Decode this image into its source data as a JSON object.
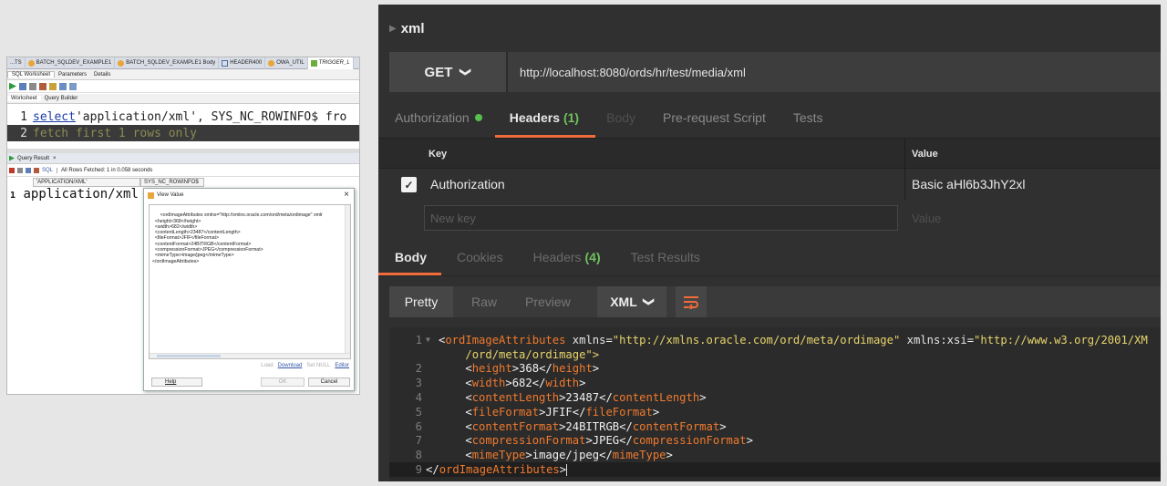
{
  "sqldev": {
    "doc_tabs": [
      {
        "label": "...TS",
        "icon": "none"
      },
      {
        "label": "BATCH_SQLDEV_EXAMPLE1",
        "icon": "orange-db-icon"
      },
      {
        "label": "BATCH_SQLDEV_EXAMPLE1 Body",
        "icon": "orange-db-icon"
      },
      {
        "label": "HEADER400",
        "icon": "table-icon"
      },
      {
        "label": "OWA_UTIL",
        "icon": "orange-db-icon"
      },
      {
        "label": "TRIGGER_L",
        "icon": "trigger-icon"
      }
    ],
    "sub_tabs": [
      "SQL Worksheet",
      "Parameters",
      "Details"
    ],
    "worksheet_tabs": [
      "Worksheet",
      "Query Builder"
    ],
    "code": [
      {
        "num": "1",
        "kw": "select",
        "rest": " 'application/xml', SYS_NC_ROWINFO$  fro"
      },
      {
        "num": "2",
        "text": "fetch first 1 rows only"
      }
    ],
    "query_result_tab": "Query Result",
    "query_result_close": "×",
    "result_toolbar_sql": "SQL",
    "result_status": "All Rows Fetched: 1 in 0.058 seconds",
    "grid_headers": [
      "'APPLICATION/XML'",
      "SYS_NC_ROWINFO$"
    ],
    "grid_row_num": "1",
    "grid_cell": "application/xml",
    "dialog": {
      "title": "View Value",
      "close": "×",
      "content": "<ordImageAttributes xmlns=\"http://xmlns.oracle.com/ord/meta/ordimage\" xmlr\n  <height>368</height>\n  <width>682</width>\n  <contentLength>23487</contentLength>\n  <fileFormat>JFIF</fileFormat>\n  <contentFormat>24BITRGB</contentFormat>\n  <compressionFormat>JPEG</compressionFormat>\n  <mimeType>image/jpeg</mimeType>\n</ordImageAttributes>",
      "links": [
        "Load",
        "Download",
        "Set NULL",
        "Editor"
      ],
      "help": "Help",
      "ok": "OK",
      "cancel": "Cancel"
    }
  },
  "postman": {
    "request_name": "xml",
    "method": "GET",
    "url": "http://localhost:8080/ords/hr/test/media/xml",
    "request_tabs": [
      {
        "label": "Authorization",
        "status": "green-dot"
      },
      {
        "label": "Headers",
        "count": "(1)",
        "active": true
      },
      {
        "label": "Body"
      },
      {
        "label": "Pre-request Script"
      },
      {
        "label": "Tests"
      }
    ],
    "headers_table": {
      "col_key": "Key",
      "col_value": "Value",
      "rows": [
        {
          "key": "Authorization",
          "value": "Basic aHl6b3JhY2xl",
          "checked": true
        }
      ],
      "new_key_placeholder": "New key",
      "new_value_placeholder": "Value"
    },
    "response_tabs": [
      {
        "label": "Body",
        "active": true
      },
      {
        "label": "Cookies"
      },
      {
        "label": "Headers",
        "count": "(4)"
      },
      {
        "label": "Test Results"
      }
    ],
    "format_bar": {
      "pretty": "Pretty",
      "raw": "Raw",
      "preview": "Preview",
      "type": "XML"
    },
    "code_lines": [
      "1",
      "2",
      "3",
      "4",
      "5",
      "6",
      "7",
      "8",
      "9"
    ],
    "xml": {
      "root_tag": "ordImageAttributes",
      "xmlns_attr": "xmlns",
      "xmlns_val": "\"http://xmlns.oracle.com/ord/meta/ordimage\"",
      "xsi_attr": "xmlns:xsi",
      "xsi_val": "\"http://www.w3.org/2001/XM",
      "wrap_line": "/ord/meta/ordimage\">",
      "elements": [
        {
          "tag": "height",
          "value": "368"
        },
        {
          "tag": "width",
          "value": "682"
        },
        {
          "tag": "contentLength",
          "value": "23487"
        },
        {
          "tag": "fileFormat",
          "value": "JFIF"
        },
        {
          "tag": "contentFormat",
          "value": "24BITRGB"
        },
        {
          "tag": "compressionFormat",
          "value": "JPEG"
        },
        {
          "tag": "mimeType",
          "value": "image/jpeg"
        }
      ]
    },
    "colors": {
      "accent": "#f26b3a",
      "tag": "#f07a2d",
      "attr_value": "#e8d46b",
      "ok_green": "#58c04e"
    }
  }
}
